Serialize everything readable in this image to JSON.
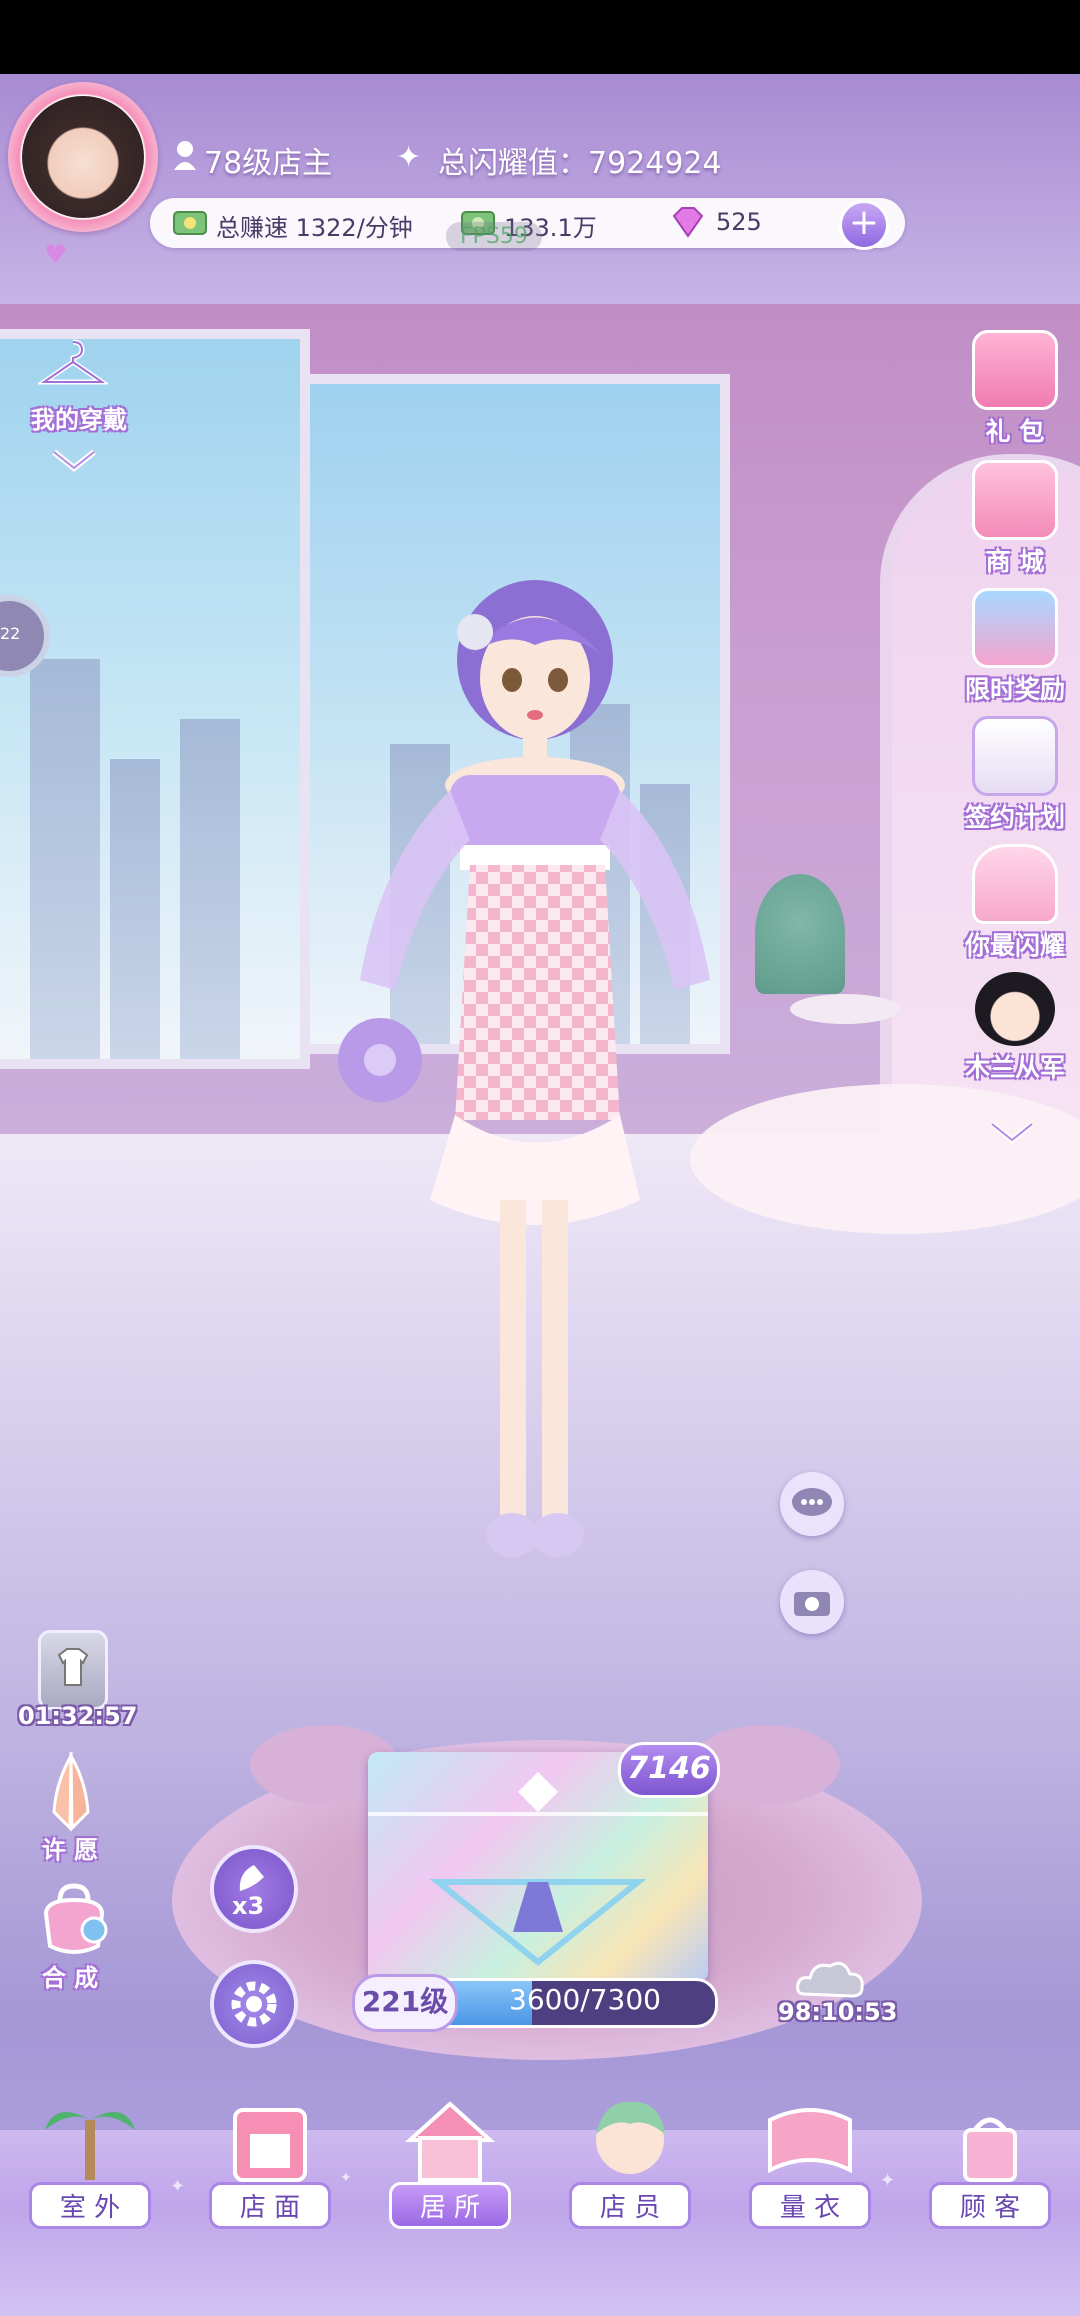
{
  "player": {
    "level_text": "78级店主",
    "glow_text": "总闪耀值：7924924"
  },
  "resources": {
    "earn_rate": "总赚速 1322/分钟",
    "cash": "133.1万",
    "gems": "525",
    "ghost_overlay": "FPS59"
  },
  "left_menu": {
    "wardrobe_label": "我的穿戴",
    "side_timer": "22",
    "clothes_timer": "01:32:57",
    "wish_label": "许 愿",
    "merge_label": "合 成"
  },
  "right_menu": {
    "items": [
      {
        "label": "礼 包",
        "icon": "gift-box-icon"
      },
      {
        "label": "商 城",
        "icon": "shop-icon"
      },
      {
        "label": "限时奖励",
        "icon": "limited-reward-icon"
      },
      {
        "label": "签约计划",
        "icon": "contract-icon"
      },
      {
        "label": "你最闪耀",
        "icon": "crown-icon"
      },
      {
        "label": "木兰从军",
        "icon": "mulan-icon"
      }
    ]
  },
  "production": {
    "box_count": "7146",
    "speed_multiplier": "x3",
    "level_badge": "221级",
    "level_progress_text": "3600/7300",
    "progress_fraction": 0.493,
    "cloud_timer": "98:10:53"
  },
  "nav": {
    "items": [
      {
        "label": "室 外",
        "icon": "palm-tree-icon"
      },
      {
        "label": "店 面",
        "icon": "storefront-icon"
      },
      {
        "label": "居 所",
        "icon": "house-icon"
      },
      {
        "label": "店 员",
        "icon": "staff-icon"
      },
      {
        "label": "量 衣",
        "icon": "tape-measure-icon"
      },
      {
        "label": "顾 客",
        "icon": "customer-icon"
      }
    ],
    "active_index": 2
  },
  "colors": {
    "accent": "#9b6ae6",
    "label_outline": "#a36fd6",
    "progress_fill": "#4b95e6"
  }
}
